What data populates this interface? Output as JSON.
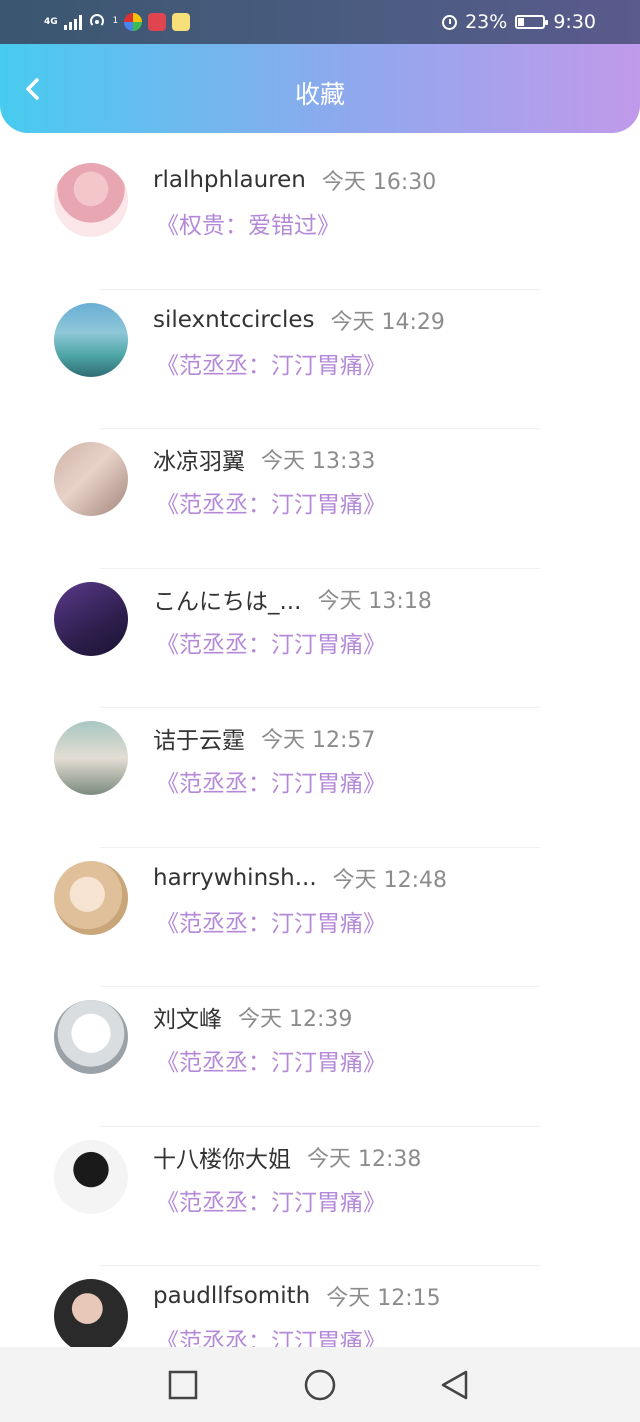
{
  "status_bar": {
    "network": "4G",
    "hotspot_count": "1",
    "battery": "23%",
    "time": "9:30"
  },
  "header": {
    "title": "收藏",
    "back_icon": "chevron-left-icon"
  },
  "items": [
    {
      "name": "rlalhphlauren",
      "time": "今天 16:30",
      "title": "《权贵：爱错过》"
    },
    {
      "name": "silexntccircles",
      "time": "今天 14:29",
      "title": "《范丞丞：汀汀胃痛》"
    },
    {
      "name": "冰凉羽翼",
      "time": "今天 13:33",
      "title": "《范丞丞：汀汀胃痛》"
    },
    {
      "name": "こんにちは_...",
      "time": "今天 13:18",
      "title": "《范丞丞：汀汀胃痛》"
    },
    {
      "name": "诘于云霆",
      "time": "今天 12:57",
      "title": "《范丞丞：汀汀胃痛》"
    },
    {
      "name": "harrywhinsh...",
      "time": "今天 12:48",
      "title": "《范丞丞：汀汀胃痛》"
    },
    {
      "name": "刘文峰",
      "time": "今天 12:39",
      "title": "《范丞丞：汀汀胃痛》"
    },
    {
      "name": "十八楼你大姐",
      "time": "今天 12:38",
      "title": "《范丞丞：汀汀胃痛》"
    },
    {
      "name": "paudllfsomith",
      "time": "今天 12:15",
      "title": "《范丞丞：汀汀胃痛》"
    }
  ],
  "nav_bar": {
    "recent_icon": "square-icon",
    "home_icon": "circle-icon",
    "back_icon": "triangle-back-icon"
  },
  "colors": {
    "header_start": "#47cbef",
    "header_end": "#c19aea",
    "title_purple": "#b48ad8",
    "time_gray": "#8c8c8c"
  }
}
